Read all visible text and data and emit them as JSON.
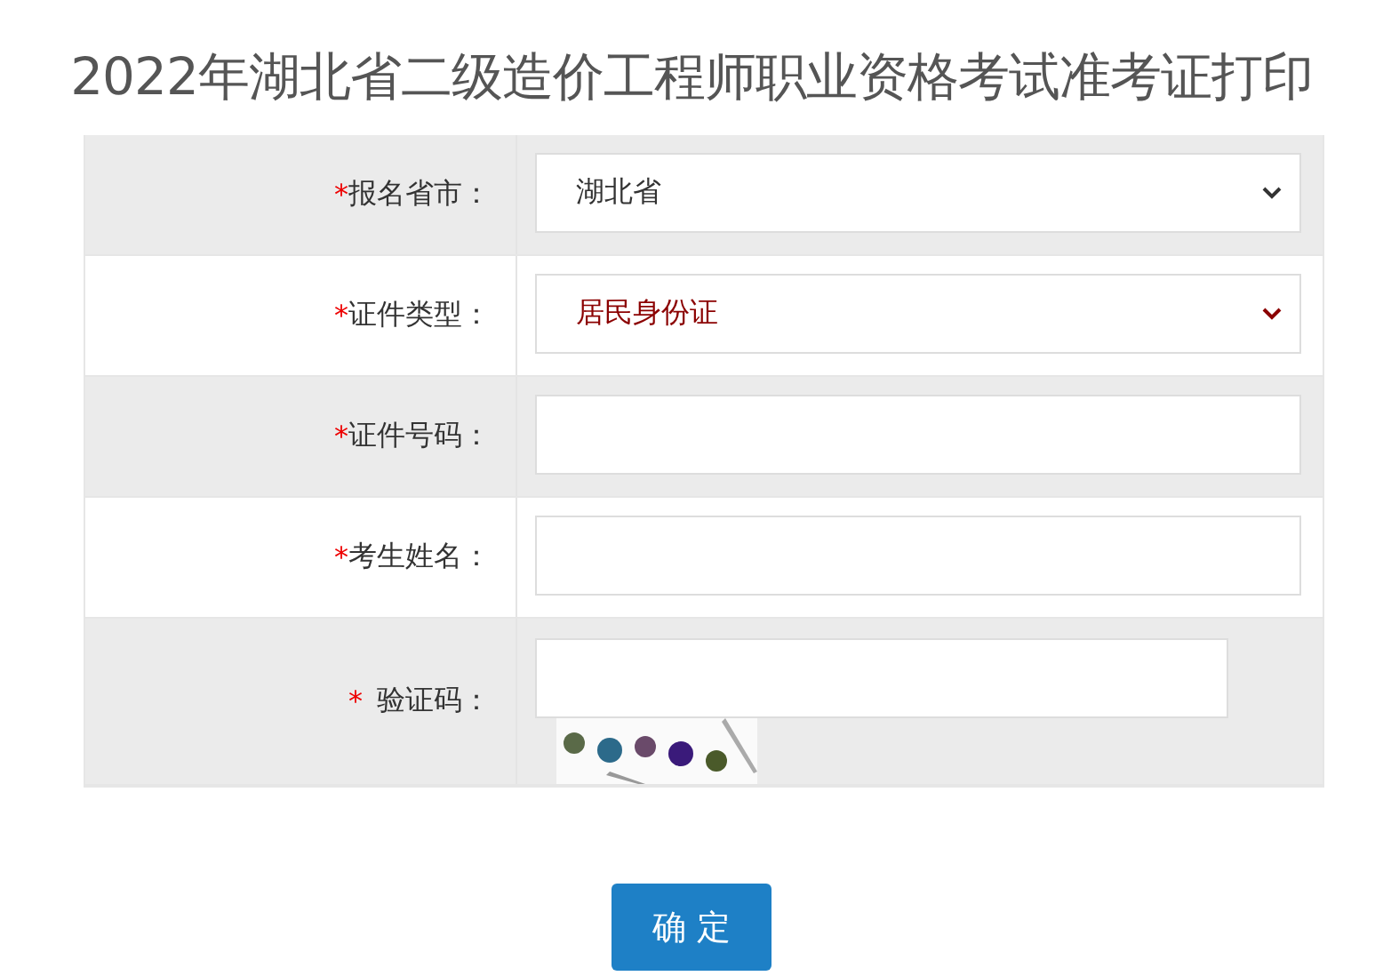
{
  "title": "2022年湖北省二级造价工程师职业资格考试准考证打印",
  "fields": [
    {
      "kind": "select",
      "required_mark": "*",
      "label": "报名省市：",
      "value": "湖北省",
      "color": "#333333"
    },
    {
      "kind": "select",
      "required_mark": "*",
      "label": "证件类型：",
      "value": "居民身份证",
      "color": "#8b0000"
    },
    {
      "kind": "input",
      "required_mark": "*",
      "label": "证件号码："
    },
    {
      "kind": "input",
      "required_mark": "*",
      "label": "考生姓名："
    },
    {
      "kind": "captcha",
      "required_mark": "*",
      "label": "验证码："
    }
  ],
  "submit": "确 定"
}
